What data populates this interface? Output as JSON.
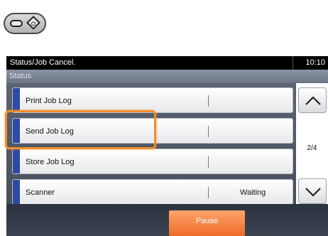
{
  "header": {
    "title": "Status/Job Cancel.",
    "clock": "10:10"
  },
  "section": {
    "label": "Status"
  },
  "rows": [
    {
      "label": "Print Job Log",
      "status": ""
    },
    {
      "label": "Send Job Log",
      "status": ""
    },
    {
      "label": "Store Job Log",
      "status": ""
    },
    {
      "label": "Scanner",
      "status": "Waiting"
    }
  ],
  "pager": {
    "indicator": "2/4",
    "up_icon": "chevron-up-icon",
    "down_icon": "chevron-down-icon"
  },
  "footer": {
    "pause_label": "Pause"
  },
  "colors": {
    "accent": "#2c4aa6",
    "pause": "#ee6b2a",
    "highlight": "#f28e2b"
  }
}
